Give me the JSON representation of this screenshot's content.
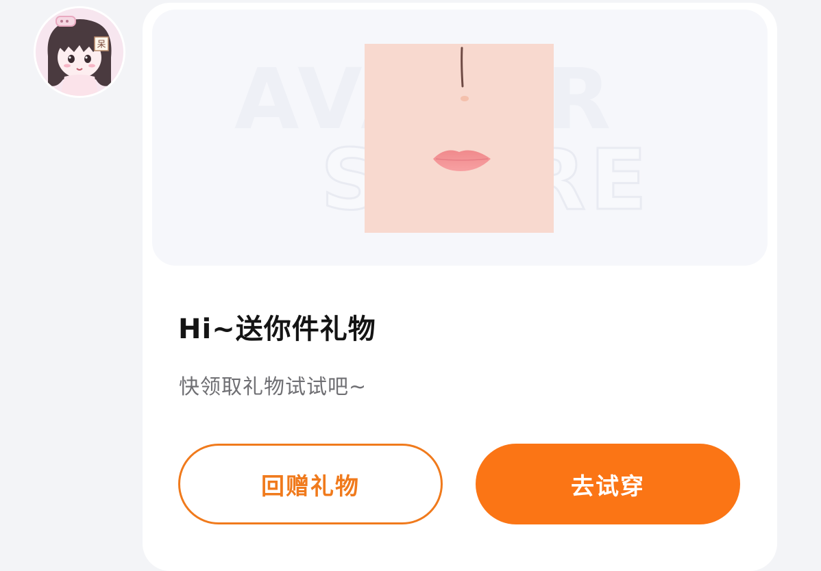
{
  "sender": {
    "avatar_badge_char": "呆"
  },
  "gift_card": {
    "watermark_line1": "AVATAR",
    "watermark_line2": "STORE",
    "title": "Hi~送你件礼物",
    "subtitle": "快领取礼物试试吧~",
    "buttons": {
      "return_gift": "回赠礼物",
      "try_on": "去试穿"
    }
  },
  "colors": {
    "accent": "#fb7515",
    "accent_outline": "#f07a1c",
    "background": "#f3f4f7",
    "card": "#ffffff",
    "title_text": "#141414",
    "subtitle_text": "#6f6f73"
  },
  "icons": {
    "sender_avatar": "cartoon-girl-avatar",
    "gift_item": "face-makeup-nose-lips"
  }
}
